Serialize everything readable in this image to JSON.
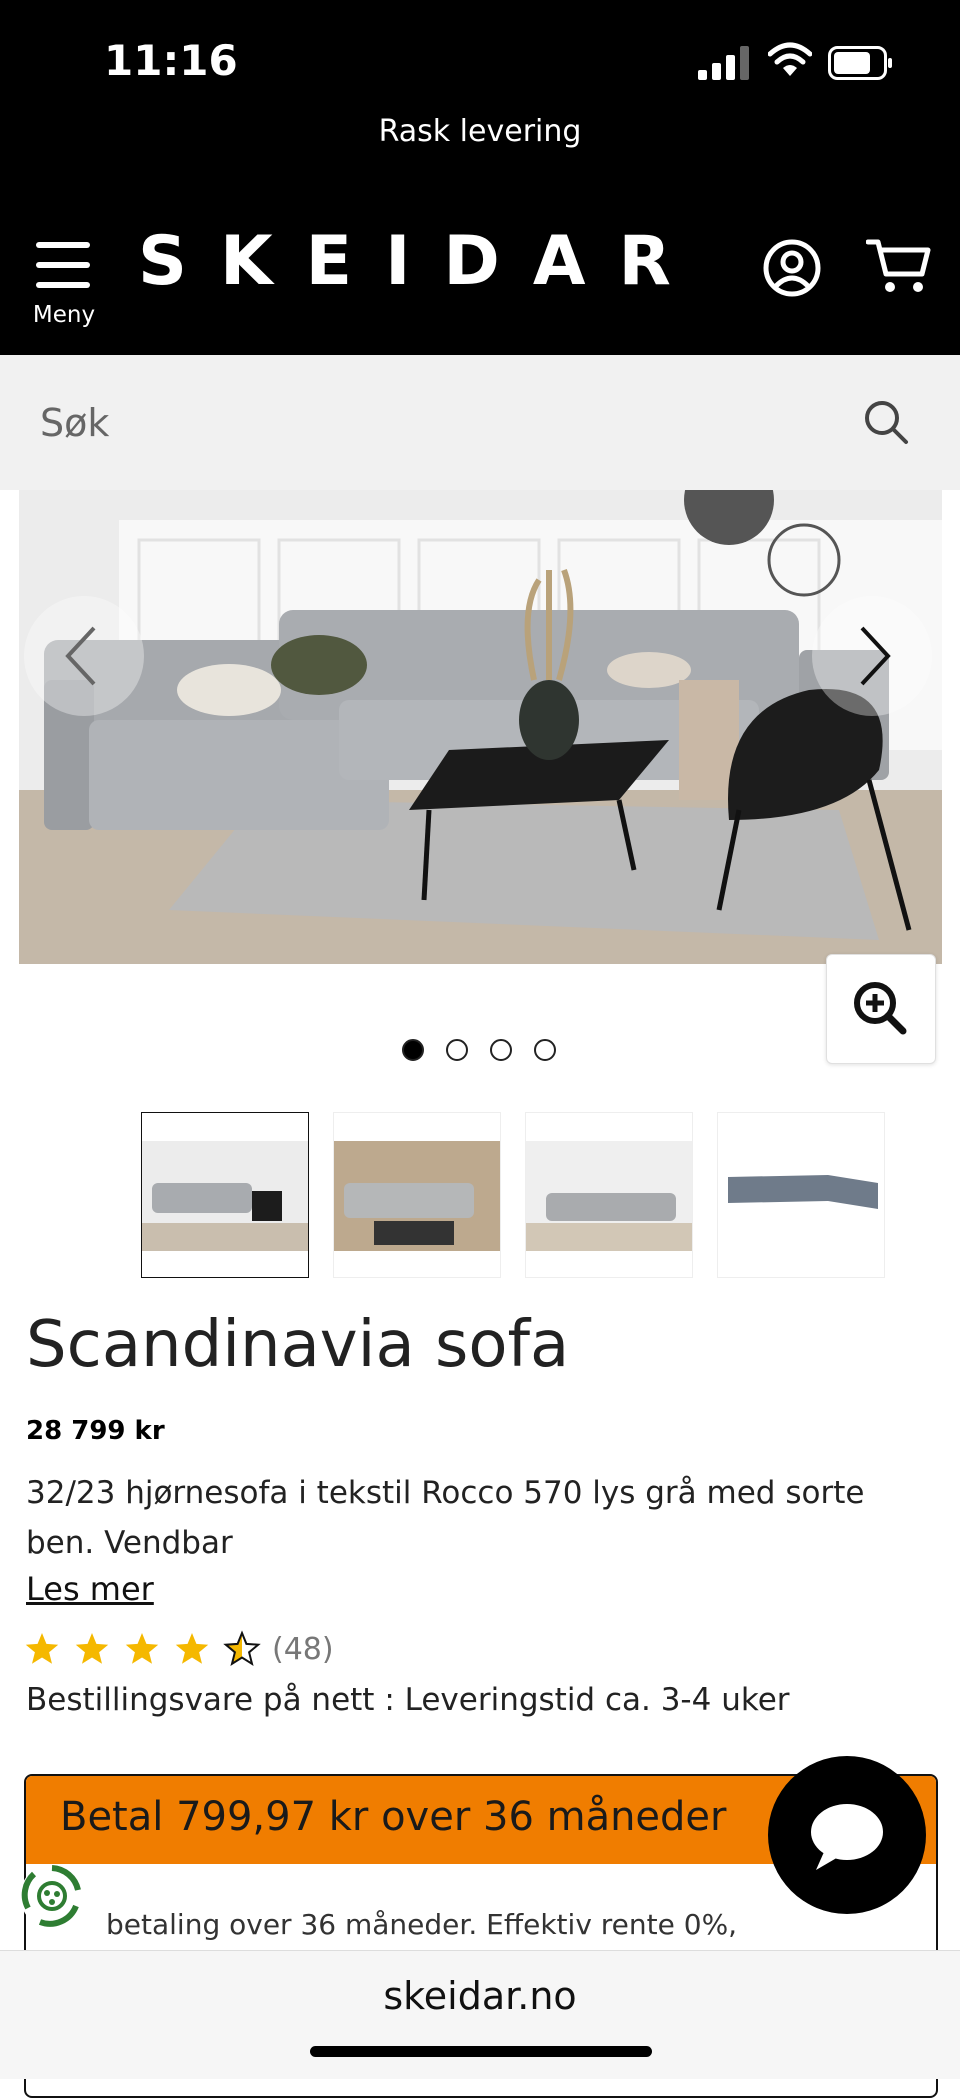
{
  "status_bar": {
    "time": "11:16"
  },
  "header": {
    "promo": "Rask levering",
    "menu_label": "Meny",
    "logo": "SKEIDAR",
    "icons": [
      "menu-icon",
      "account-icon",
      "cart-icon"
    ]
  },
  "search": {
    "placeholder": "Søk",
    "icon": "search-icon"
  },
  "gallery": {
    "current_slide": 1,
    "total_slides": 4,
    "thumbnails_count": 4,
    "selected_thumbnail": 1
  },
  "product": {
    "title": "Scandinavia sofa",
    "price": "28 799 kr",
    "description": "32/23 hjørnesofa i tekstil Rocco 570 lys grå med sorte ben. Vendbar",
    "read_more": "Les mer",
    "rating": 4.5,
    "rating_max": 5,
    "review_count": "(48)",
    "delivery": "Bestillingsvare på nett : Leveringstid ca. 3-4 uker"
  },
  "financing": {
    "title": "Betal 799,97 kr over 36 måneder",
    "detail": "betaling over 36 måneder. Effektiv rente 0%,"
  },
  "browser": {
    "url": "skeidar.no"
  },
  "colors": {
    "header_bg": "#000000",
    "accent_orange": "#f07d00",
    "star": "#f5b800"
  }
}
